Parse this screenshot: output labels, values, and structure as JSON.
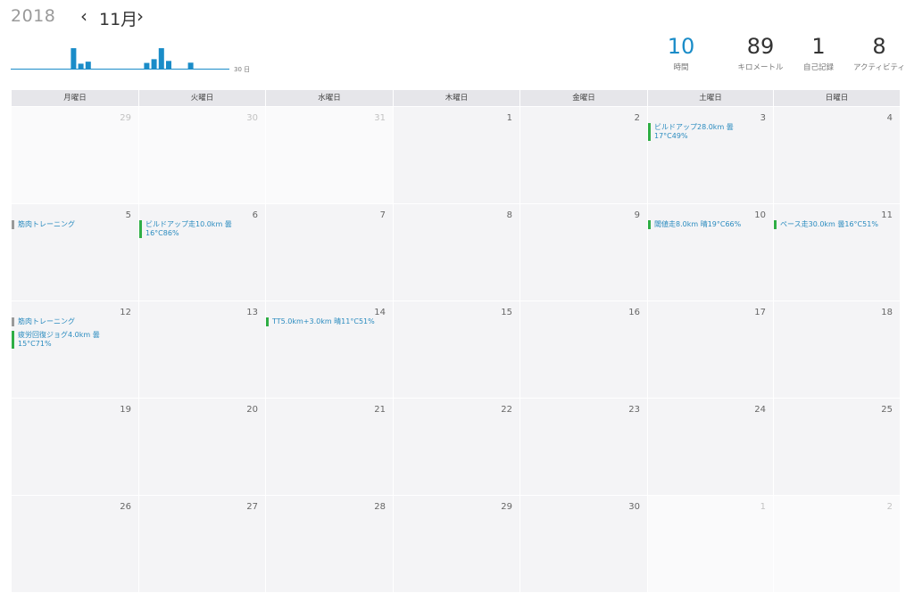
{
  "header": {
    "year": "2018",
    "month": "11月",
    "prev_icon": "‹",
    "next_icon": "›",
    "mini_chart": {
      "axis_label": "30 日",
      "bars": [
        0,
        0,
        0,
        0,
        0,
        0,
        0,
        0.82,
        0.2,
        0.28,
        0,
        0,
        0,
        0,
        0,
        0,
        0,
        0.23,
        0.38,
        0.82,
        0.31,
        0,
        0,
        0.24,
        0,
        0,
        0,
        0,
        0,
        0
      ],
      "bar_color": "#1a8cc8",
      "axis_color": "#1a8cc8"
    },
    "stats": [
      {
        "value": "10",
        "label": "時間",
        "accent": true
      },
      {
        "value": "89",
        "label": "キロメートル",
        "accent": false
      },
      {
        "value": "1",
        "label": "自己記録",
        "accent": false
      },
      {
        "value": "8",
        "label": "アクティビティ",
        "accent": false
      }
    ]
  },
  "calendar": {
    "weekdays": [
      "月曜日",
      "火曜日",
      "水曜日",
      "木曜日",
      "金曜日",
      "土曜日",
      "日曜日"
    ],
    "weeks": [
      [
        {
          "day": "29",
          "other": true,
          "events": []
        },
        {
          "day": "30",
          "other": true,
          "events": []
        },
        {
          "day": "31",
          "other": true,
          "events": []
        },
        {
          "day": "1",
          "other": false,
          "events": []
        },
        {
          "day": "2",
          "other": false,
          "events": []
        },
        {
          "day": "3",
          "other": false,
          "events": [
            {
              "text": "ビルドアップ28.0km 曇17°C49%",
              "kind": "run"
            }
          ]
        },
        {
          "day": "4",
          "other": false,
          "events": []
        }
      ],
      [
        {
          "day": "5",
          "other": false,
          "events": [
            {
              "text": "筋肉トレーニング",
              "kind": "strength"
            }
          ]
        },
        {
          "day": "6",
          "other": false,
          "events": [
            {
              "text": "ビルドアップ走10.0km 曇16°C86%",
              "kind": "run"
            }
          ]
        },
        {
          "day": "7",
          "other": false,
          "events": []
        },
        {
          "day": "8",
          "other": false,
          "events": []
        },
        {
          "day": "9",
          "other": false,
          "events": []
        },
        {
          "day": "10",
          "other": false,
          "events": [
            {
              "text": "閾値走8.0km 晴19°C66%",
              "kind": "run"
            }
          ]
        },
        {
          "day": "11",
          "other": false,
          "events": [
            {
              "text": "ペース走30.0km 曇16°C51%",
              "kind": "run"
            }
          ]
        }
      ],
      [
        {
          "day": "12",
          "other": false,
          "events": [
            {
              "text": "筋肉トレーニング",
              "kind": "strength"
            },
            {
              "text": "疲労回復ジョグ4.0km 曇15°C71%",
              "kind": "run"
            }
          ]
        },
        {
          "day": "13",
          "other": false,
          "events": []
        },
        {
          "day": "14",
          "other": false,
          "events": [
            {
              "text": "TT5.0km+3.0km 晴11°C51%",
              "kind": "run"
            }
          ]
        },
        {
          "day": "15",
          "other": false,
          "events": []
        },
        {
          "day": "16",
          "other": false,
          "events": []
        },
        {
          "day": "17",
          "other": false,
          "events": []
        },
        {
          "day": "18",
          "other": false,
          "events": []
        }
      ],
      [
        {
          "day": "19",
          "other": false,
          "events": []
        },
        {
          "day": "20",
          "other": false,
          "events": []
        },
        {
          "day": "21",
          "other": false,
          "events": []
        },
        {
          "day": "22",
          "other": false,
          "events": []
        },
        {
          "day": "23",
          "other": false,
          "events": []
        },
        {
          "day": "24",
          "other": false,
          "events": []
        },
        {
          "day": "25",
          "other": false,
          "events": []
        }
      ],
      [
        {
          "day": "26",
          "other": false,
          "events": []
        },
        {
          "day": "27",
          "other": false,
          "events": []
        },
        {
          "day": "28",
          "other": false,
          "events": []
        },
        {
          "day": "29",
          "other": false,
          "events": []
        },
        {
          "day": "30",
          "other": false,
          "events": []
        },
        {
          "day": "1",
          "other": true,
          "events": []
        },
        {
          "day": "2",
          "other": true,
          "events": []
        }
      ]
    ]
  }
}
